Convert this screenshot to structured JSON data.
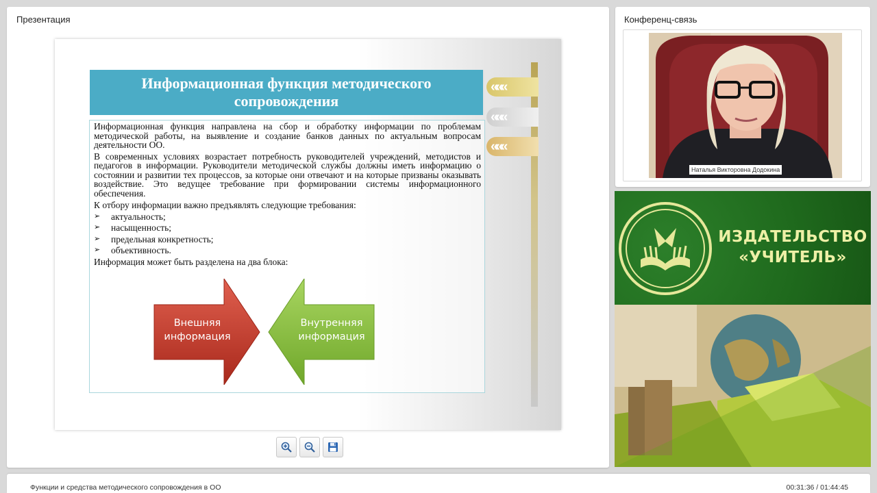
{
  "presentation": {
    "panel_title": "Презентация",
    "slide": {
      "title": "Информационная функция методического сопровождения",
      "paragraph1": "Информационная функция направлена на сбор и обработку информации по проблемам методической работы, на выявление и создание банков данных по актуальным вопросам деятельности ОО.",
      "paragraph2": "В современных условиях возрастает потребность руководителей учреждений, методистов и педагогов в информации. Руководители методической службы должны иметь информацию о состоянии и развитии тех процессов, за которые они отвечают и на которые призваны оказывать воздействие. Это ведущее требование при формировании системы информационного обеспечения.",
      "requirements_intro": " К отбору информации важно предъявлять следующие требования:",
      "bullet_mark": "➢",
      "bullets": [
        "актуальность;",
        "насыщенность;",
        "предельная конкретность;",
        "объективность."
      ],
      "blocks_intro": "Информация может быть разделена на два блока:",
      "arrow_left": "Внешняя информация",
      "arrow_right": "Внутренняя информация"
    },
    "tools": {
      "zoom_in_icon": "zoom-in-icon",
      "zoom_out_icon": "zoom-out-icon",
      "save_icon": "save-icon"
    }
  },
  "conference": {
    "panel_title": "Конференц-связь",
    "participant_name": "Наталья Викторовна Додокина"
  },
  "publisher": {
    "name_line1": "ИЗДАТЕЛЬСТВО",
    "name_line2": "«УЧИТЕЛЬ»"
  },
  "footer": {
    "lecture_title": "Функции и средства методического сопровождения в ОО",
    "time": "00:31:36 / 01:44:45"
  },
  "colors": {
    "slide_title_bg": "#4bacc6",
    "arrow_red": "#c0392b",
    "arrow_green": "#8bbf3c",
    "publisher_green": "#1f6a1d",
    "publisher_text": "#eef0a6"
  }
}
